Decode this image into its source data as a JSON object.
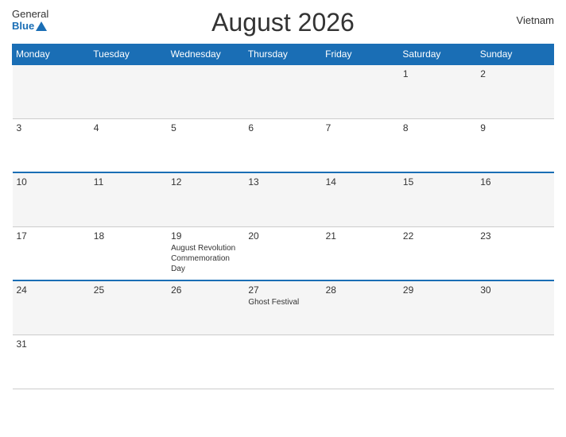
{
  "header": {
    "logo": {
      "general": "General",
      "blue": "Blue"
    },
    "title": "August 2026",
    "country": "Vietnam"
  },
  "weekdays": [
    "Monday",
    "Tuesday",
    "Wednesday",
    "Thursday",
    "Friday",
    "Saturday",
    "Sunday"
  ],
  "weeks": [
    [
      {
        "day": "",
        "holiday": ""
      },
      {
        "day": "",
        "holiday": ""
      },
      {
        "day": "",
        "holiday": ""
      },
      {
        "day": "",
        "holiday": ""
      },
      {
        "day": "",
        "holiday": ""
      },
      {
        "day": "1",
        "holiday": ""
      },
      {
        "day": "2",
        "holiday": ""
      }
    ],
    [
      {
        "day": "3",
        "holiday": ""
      },
      {
        "day": "4",
        "holiday": ""
      },
      {
        "day": "5",
        "holiday": ""
      },
      {
        "day": "6",
        "holiday": ""
      },
      {
        "day": "7",
        "holiday": ""
      },
      {
        "day": "8",
        "holiday": ""
      },
      {
        "day": "9",
        "holiday": ""
      }
    ],
    [
      {
        "day": "10",
        "holiday": ""
      },
      {
        "day": "11",
        "holiday": ""
      },
      {
        "day": "12",
        "holiday": ""
      },
      {
        "day": "13",
        "holiday": ""
      },
      {
        "day": "14",
        "holiday": ""
      },
      {
        "day": "15",
        "holiday": ""
      },
      {
        "day": "16",
        "holiday": ""
      }
    ],
    [
      {
        "day": "17",
        "holiday": ""
      },
      {
        "day": "18",
        "holiday": ""
      },
      {
        "day": "19",
        "holiday": "August Revolution Commemoration Day"
      },
      {
        "day": "20",
        "holiday": ""
      },
      {
        "day": "21",
        "holiday": ""
      },
      {
        "day": "22",
        "holiday": ""
      },
      {
        "day": "23",
        "holiday": ""
      }
    ],
    [
      {
        "day": "24",
        "holiday": ""
      },
      {
        "day": "25",
        "holiday": ""
      },
      {
        "day": "26",
        "holiday": ""
      },
      {
        "day": "27",
        "holiday": "Ghost Festival"
      },
      {
        "day": "28",
        "holiday": ""
      },
      {
        "day": "29",
        "holiday": ""
      },
      {
        "day": "30",
        "holiday": ""
      }
    ],
    [
      {
        "day": "31",
        "holiday": ""
      },
      {
        "day": "",
        "holiday": ""
      },
      {
        "day": "",
        "holiday": ""
      },
      {
        "day": "",
        "holiday": ""
      },
      {
        "day": "",
        "holiday": ""
      },
      {
        "day": "",
        "holiday": ""
      },
      {
        "day": "",
        "holiday": ""
      }
    ]
  ],
  "blue_rows": [
    0,
    2,
    4
  ]
}
